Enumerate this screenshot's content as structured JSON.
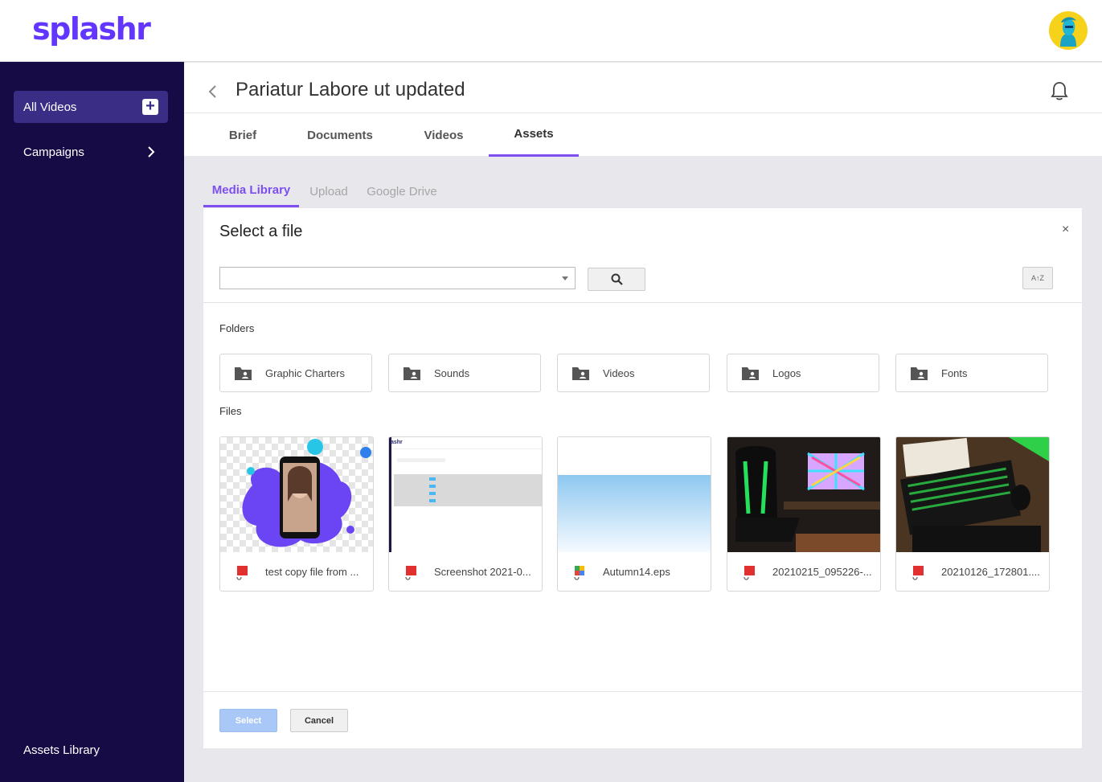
{
  "brand": {
    "name": "splashr",
    "color": "#6236ff"
  },
  "sidebar": {
    "items": [
      {
        "label": "All Videos",
        "icon": "plus-icon"
      },
      {
        "label": "Campaigns",
        "icon": "chevron-right-icon"
      }
    ],
    "footer_label": "Assets Library"
  },
  "header": {
    "title": "Pariatur Labore ut updated"
  },
  "tabs": [
    {
      "label": "Brief"
    },
    {
      "label": "Documents"
    },
    {
      "label": "Videos"
    },
    {
      "label": "Assets",
      "active": true
    }
  ],
  "subtabs": [
    {
      "label": "Media Library",
      "active": true
    },
    {
      "label": "Upload"
    },
    {
      "label": "Google Drive"
    }
  ],
  "dialog": {
    "title": "Select a file",
    "close": "×",
    "search_value": "",
    "sort_label": "A↑Z",
    "folders_label": "Folders",
    "files_label": "Files",
    "folders": [
      {
        "name": "Graphic Charters"
      },
      {
        "name": "Sounds"
      },
      {
        "name": "Videos"
      },
      {
        "name": "Logos"
      },
      {
        "name": "Fonts"
      }
    ],
    "files": [
      {
        "name": "test copy file from ...",
        "file_icon": "adobe-file-icon"
      },
      {
        "name": "Screenshot 2021-0...",
        "file_icon": "adobe-file-icon"
      },
      {
        "name": "Autumn14.eps",
        "file_icon": "google-file-icon"
      },
      {
        "name": "20210215_095226-...",
        "file_icon": "adobe-file-icon"
      },
      {
        "name": "20210126_172801....",
        "file_icon": "adobe-file-icon"
      }
    ],
    "select_label": "Select",
    "cancel_label": "Cancel"
  },
  "colors": {
    "accent": "#7d4ff0",
    "sidebar_bg": "#170b46",
    "sidebar_active": "#3a2d86"
  }
}
